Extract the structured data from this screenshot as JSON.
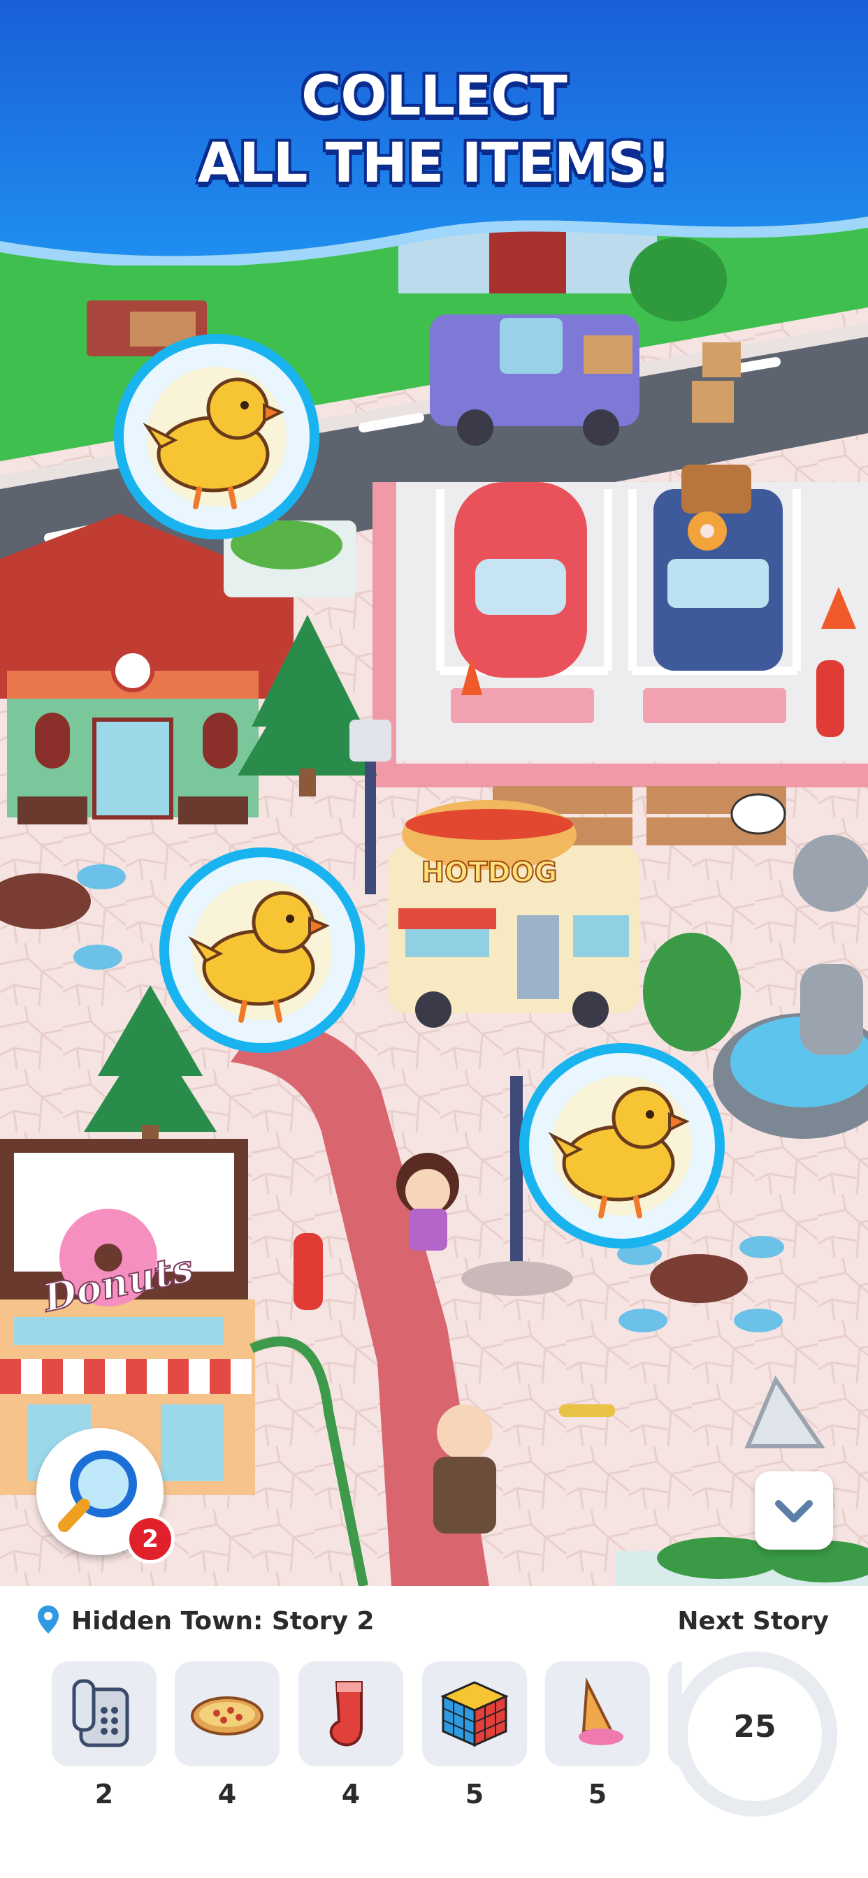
{
  "banner": {
    "line1": "COLLECT",
    "line2": "ALL THE ITEMS!"
  },
  "scene": {
    "food_truck_sign": "HOTDOG",
    "shop_sign": "Donuts",
    "targets": [
      {
        "icon": "chick-icon"
      },
      {
        "icon": "chick-icon"
      },
      {
        "icon": "chick-icon"
      }
    ]
  },
  "search": {
    "icon": "magnifier-icon",
    "badge": "2"
  },
  "collapse": {
    "icon": "chevron-down-icon"
  },
  "panel": {
    "story_title": "Hidden Town: Story 2",
    "next_label": "Next Story",
    "next_count": "25",
    "items": [
      {
        "icon": "telephone-icon",
        "count": "2"
      },
      {
        "icon": "pizza-icon",
        "count": "4"
      },
      {
        "icon": "sock-icon",
        "count": "4"
      },
      {
        "icon": "rubiks-cube-icon",
        "count": "5"
      },
      {
        "icon": "ice-cream-cone-icon",
        "count": "5"
      }
    ]
  },
  "colors": {
    "banner_blue": "#1e74e6",
    "target_ring": "#19b3ef",
    "badge_red": "#e0202b"
  }
}
